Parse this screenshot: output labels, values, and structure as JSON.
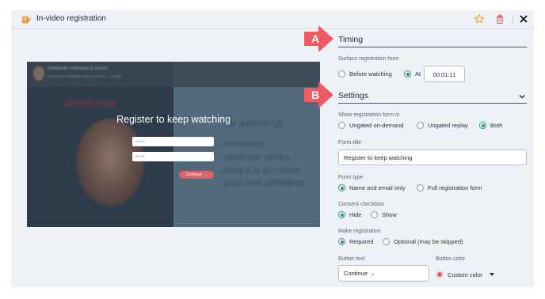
{
  "window": {
    "title": "In-video registration"
  },
  "preview": {
    "webinar_title": "uWebinar Overview & Demo",
    "webinar_subtitle": "Created by uWebinar Team Ana Ana · 1 minute",
    "brand": "uWebinar",
    "heading_blur": "...for watching!",
    "blur_lines": [
      "...backstory",
      "...uwebinar works",
      "...easy it is to create",
      "...your own uWebinar"
    ],
    "overlay_title": "Register to keep watching",
    "name_placeholder": "Name",
    "email_placeholder": "Email",
    "button": "Continue →"
  },
  "callouts": {
    "a": "A",
    "b": "B"
  },
  "timing": {
    "title": "Timing",
    "surface_label": "Surface registration form",
    "before_watching": "Before watching",
    "at": "At",
    "time": "00:01:11"
  },
  "settings": {
    "title": "Settings",
    "show_in_label": "Show registration form in",
    "ungated_on_demand": "Ungated on-demand",
    "ungated_replay": "Ungated replay",
    "both": "Both",
    "form_title_label": "Form title",
    "form_title_value": "Register to keep watching",
    "form_type_label": "Form type",
    "name_email_only": "Name and email only",
    "full_registration": "Full registration form",
    "consent_label": "Consent checkbox",
    "hide": "Hide",
    "show": "Show",
    "make_reg_label": "Make registration",
    "required": "Required",
    "optional": "Optional (may be skipped)",
    "button_text_label": "Button text",
    "button_text_value": "Continue →",
    "button_color_label": "Button color",
    "custom_color": "Custom color"
  },
  "colors": {
    "accent": "#2d8c8f",
    "callout": "#ef5b62",
    "button_color": "#e05a5a",
    "trash": "#e05a5a",
    "star": "#e2a52c",
    "header_icon": "#e8a04a"
  },
  "icons": [
    "registration-form-icon",
    "star-icon",
    "trash-icon",
    "close-icon",
    "chevron-down-icon",
    "caret-down-icon"
  ]
}
